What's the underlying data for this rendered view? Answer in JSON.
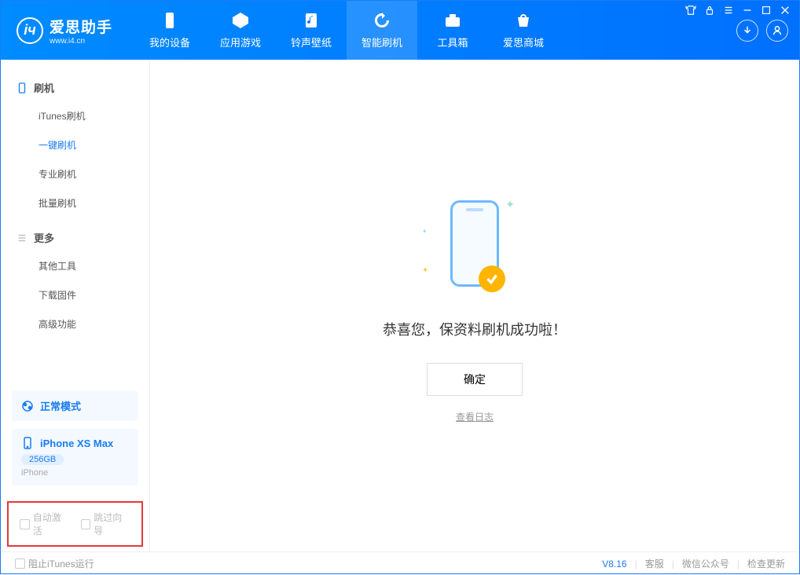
{
  "header": {
    "app_title": "爱思助手",
    "app_url": "www.i4.cn",
    "tabs": [
      {
        "label": "我的设备"
      },
      {
        "label": "应用游戏"
      },
      {
        "label": "铃声壁纸"
      },
      {
        "label": "智能刷机"
      },
      {
        "label": "工具箱"
      },
      {
        "label": "爱思商城"
      }
    ]
  },
  "sidebar": {
    "group1_title": "刷机",
    "group1_items": [
      "iTunes刷机",
      "一键刷机",
      "专业刷机",
      "批量刷机"
    ],
    "group2_title": "更多",
    "group2_items": [
      "其他工具",
      "下载固件",
      "高级功能"
    ],
    "mode_label": "正常模式",
    "device_name": "iPhone XS Max",
    "device_storage": "256GB",
    "device_type": "iPhone",
    "checkbox1": "自动激活",
    "checkbox2": "跳过向导"
  },
  "main": {
    "success_text": "恭喜您，保资料刷机成功啦！",
    "ok_button": "确定",
    "log_link": "查看日志"
  },
  "footer": {
    "block_itunes": "阻止iTunes运行",
    "version": "V8.16",
    "link1": "客服",
    "link2": "微信公众号",
    "link3": "检查更新"
  }
}
